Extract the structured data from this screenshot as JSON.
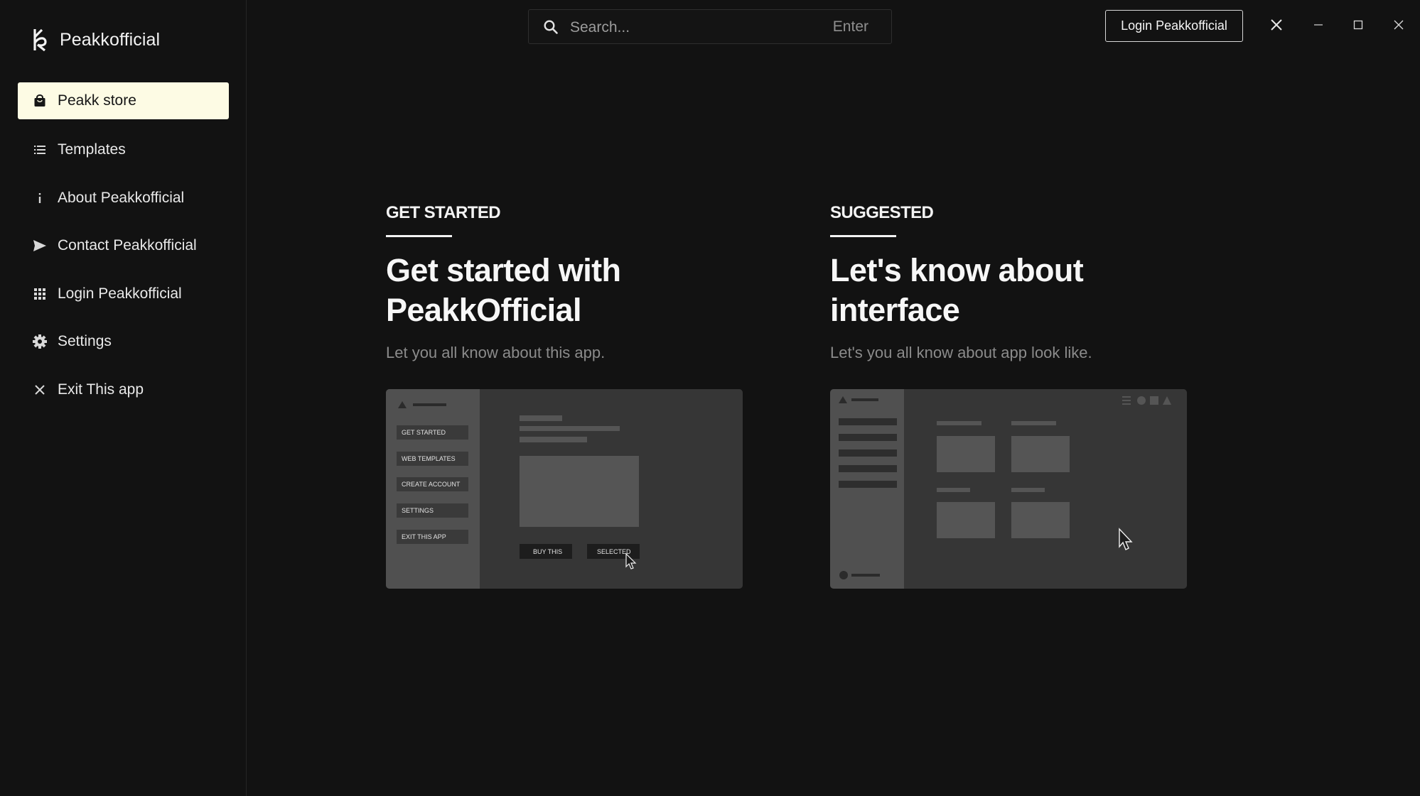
{
  "app": {
    "brand_name": "Peakkofficial"
  },
  "sidebar": {
    "items": [
      {
        "label": "Peakk store",
        "icon": "shopping-bag-icon",
        "active": true
      },
      {
        "label": "Templates",
        "icon": "list-icon"
      },
      {
        "label": "About Peakkofficial",
        "icon": "info-icon"
      },
      {
        "label": "Contact Peakkofficial",
        "icon": "send-icon"
      },
      {
        "label": "Login Peakkofficial",
        "icon": "grid-icon"
      },
      {
        "label": "Settings",
        "icon": "gear-icon"
      },
      {
        "label": "Exit This app",
        "icon": "close-icon"
      }
    ]
  },
  "topbar": {
    "search_placeholder": "Search...",
    "search_hint": "Enter",
    "login_label": "Login Peakkofficial",
    "window_controls": [
      "close-icon",
      "minimize-icon",
      "maximize-icon",
      "window-close-icon"
    ]
  },
  "cards": [
    {
      "eyebrow": "GET STARTED",
      "title": "Get started with PeakkOfficial",
      "subtitle": "Let you all know about this app.",
      "preview": {
        "menu": [
          "GET STARTED",
          "WEB TEMPLATES",
          "CREATE ACCOUNT",
          "SETTINGS",
          "EXIT THIS APP"
        ],
        "buttons": [
          "BUY THIS",
          "SELECTED"
        ]
      }
    },
    {
      "eyebrow": "SUGGESTED",
      "title": "Let's know about interface",
      "subtitle": "Let's you all know about app look like.",
      "preview": {}
    }
  ],
  "colors": {
    "background": "#121212",
    "active_item_bg": "#fdfbe4",
    "subtitle_text": "#8b8b8b",
    "preview_bg": "#323232"
  }
}
